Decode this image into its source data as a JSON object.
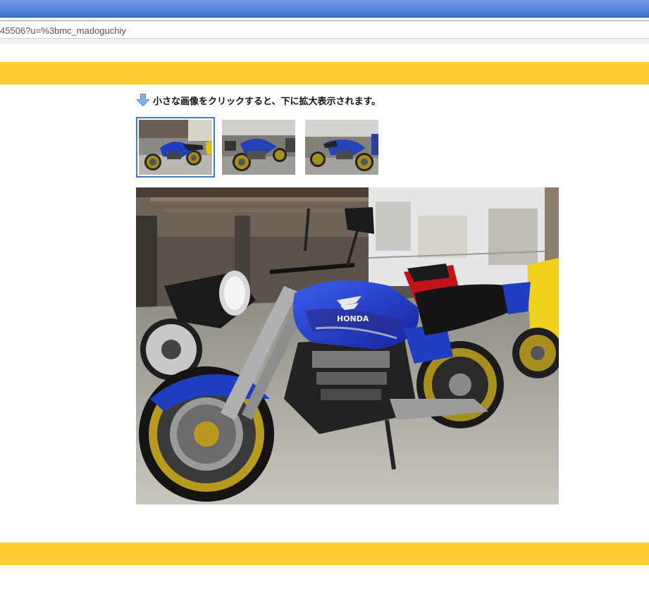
{
  "browser": {
    "address_text": "45506?u=%3bmc_madoguchiy"
  },
  "gallery": {
    "instruction": "小さな画像をクリックすると、下に拡大表示されます。",
    "thumbnails": [
      {
        "label": "thumbnail-1",
        "selected": true
      },
      {
        "label": "thumbnail-2",
        "selected": false
      },
      {
        "label": "thumbnail-3",
        "selected": false
      }
    ]
  },
  "photo": {
    "tank_brand": "HONDA"
  },
  "colors": {
    "band": "#ffcc33",
    "selected_border": "#3a7fc0",
    "bike_blue": "#1f3fc0",
    "wheel_gold": "#b89a1e"
  }
}
